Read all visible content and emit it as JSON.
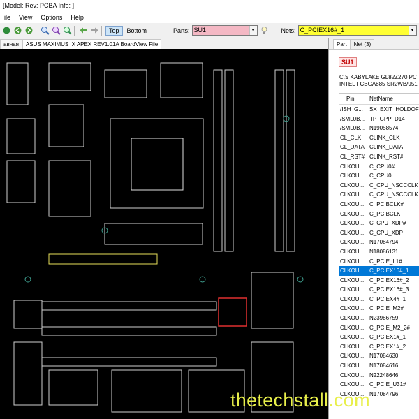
{
  "title": "[Model: Rev:  PCBA Info: ]",
  "menu": [
    "ile",
    "View",
    "Options",
    "Help"
  ],
  "toolbar": {
    "top_label": "Top",
    "bottom_label": "Bottom",
    "parts_label": "Parts:",
    "parts_value": "SU1",
    "nets_label": "Nets:",
    "nets_value": "C_PCIEX16#_1",
    "parts_bg": "#f4b8c4",
    "nets_bg": "#ffff33",
    "icons": [
      "open-icon",
      "back-icon",
      "forward-icon",
      "zoom-in-icon",
      "zoom-out-icon",
      "zoom-fit-icon",
      "arrow-left-icon",
      "arrow-right-icon",
      "lightbulb-icon"
    ]
  },
  "doc_tabs": [
    "авная",
    "ASUS MAXIMUS IX APEX REV1.01A BoardView File"
  ],
  "panel": {
    "tabs": [
      "Part",
      "Net (3)"
    ],
    "part_name": "SU1",
    "desc_line1": "C.S KABYLAKE GL82Z270 PC",
    "desc_line2": "INTEL FCBGA885 SR2WB/951",
    "col_pin": "Pin",
    "col_net": "NetName",
    "rows": [
      {
        "pin": "/ISH_G...",
        "net": "SX_EXIT_HOLDOF"
      },
      {
        "pin": "/SML0B...",
        "net": "TP_GPP_D14"
      },
      {
        "pin": "/SML0B...",
        "net": "N19058574"
      },
      {
        "pin": "CL_CLK",
        "net": "CLINK_CLK"
      },
      {
        "pin": "CL_DATA",
        "net": "CLINK_DATA"
      },
      {
        "pin": "CL_RST#",
        "net": "CLINK_RST#"
      },
      {
        "pin": "CLKOU...",
        "net": "C_CPU0#"
      },
      {
        "pin": "CLKOU...",
        "net": "C_CPU0"
      },
      {
        "pin": "CLKOU...",
        "net": "C_CPU_NSCCCLK"
      },
      {
        "pin": "CLKOU...",
        "net": "C_CPU_NSCCCLK"
      },
      {
        "pin": "CLKOU...",
        "net": "C_PCIBCLK#"
      },
      {
        "pin": "CLKOU...",
        "net": "C_PCIBCLK"
      },
      {
        "pin": "CLKOU...",
        "net": "C_CPU_XDP#"
      },
      {
        "pin": "CLKOU...",
        "net": "C_CPU_XDP"
      },
      {
        "pin": "CLKOU...",
        "net": "N17084794"
      },
      {
        "pin": "CLKOU...",
        "net": "N18086131"
      },
      {
        "pin": "CLKOU...",
        "net": "C_PCIE_L1#"
      },
      {
        "pin": "CLKOU...",
        "net": "C_PCIEX16#_1"
      },
      {
        "pin": "CLKOU...",
        "net": "C_PCIEX16#_2"
      },
      {
        "pin": "CLKOU...",
        "net": "C_PCIEX16#_3"
      },
      {
        "pin": "CLKOU...",
        "net": "C_PCIEX4#_1"
      },
      {
        "pin": "CLKOU...",
        "net": "C_PCIE_M2#"
      },
      {
        "pin": "CLKOU...",
        "net": "N23986759"
      },
      {
        "pin": "CLKOU...",
        "net": "C_PCIE_M2_2#"
      },
      {
        "pin": "CLKOU...",
        "net": "C_PCIEX1#_1"
      },
      {
        "pin": "CLKOU...",
        "net": "C_PCIEX1#_2"
      },
      {
        "pin": "CLKOU...",
        "net": "N17084630"
      },
      {
        "pin": "CLKOU...",
        "net": "N17084616"
      },
      {
        "pin": "CLKOU...",
        "net": "N22248646"
      },
      {
        "pin": "CLKOU...",
        "net": "C_PCIE_U31#"
      },
      {
        "pin": "CLKOU...",
        "net": "N17084796"
      }
    ],
    "selected_index": 17
  },
  "watermark": "thetechstall.com"
}
